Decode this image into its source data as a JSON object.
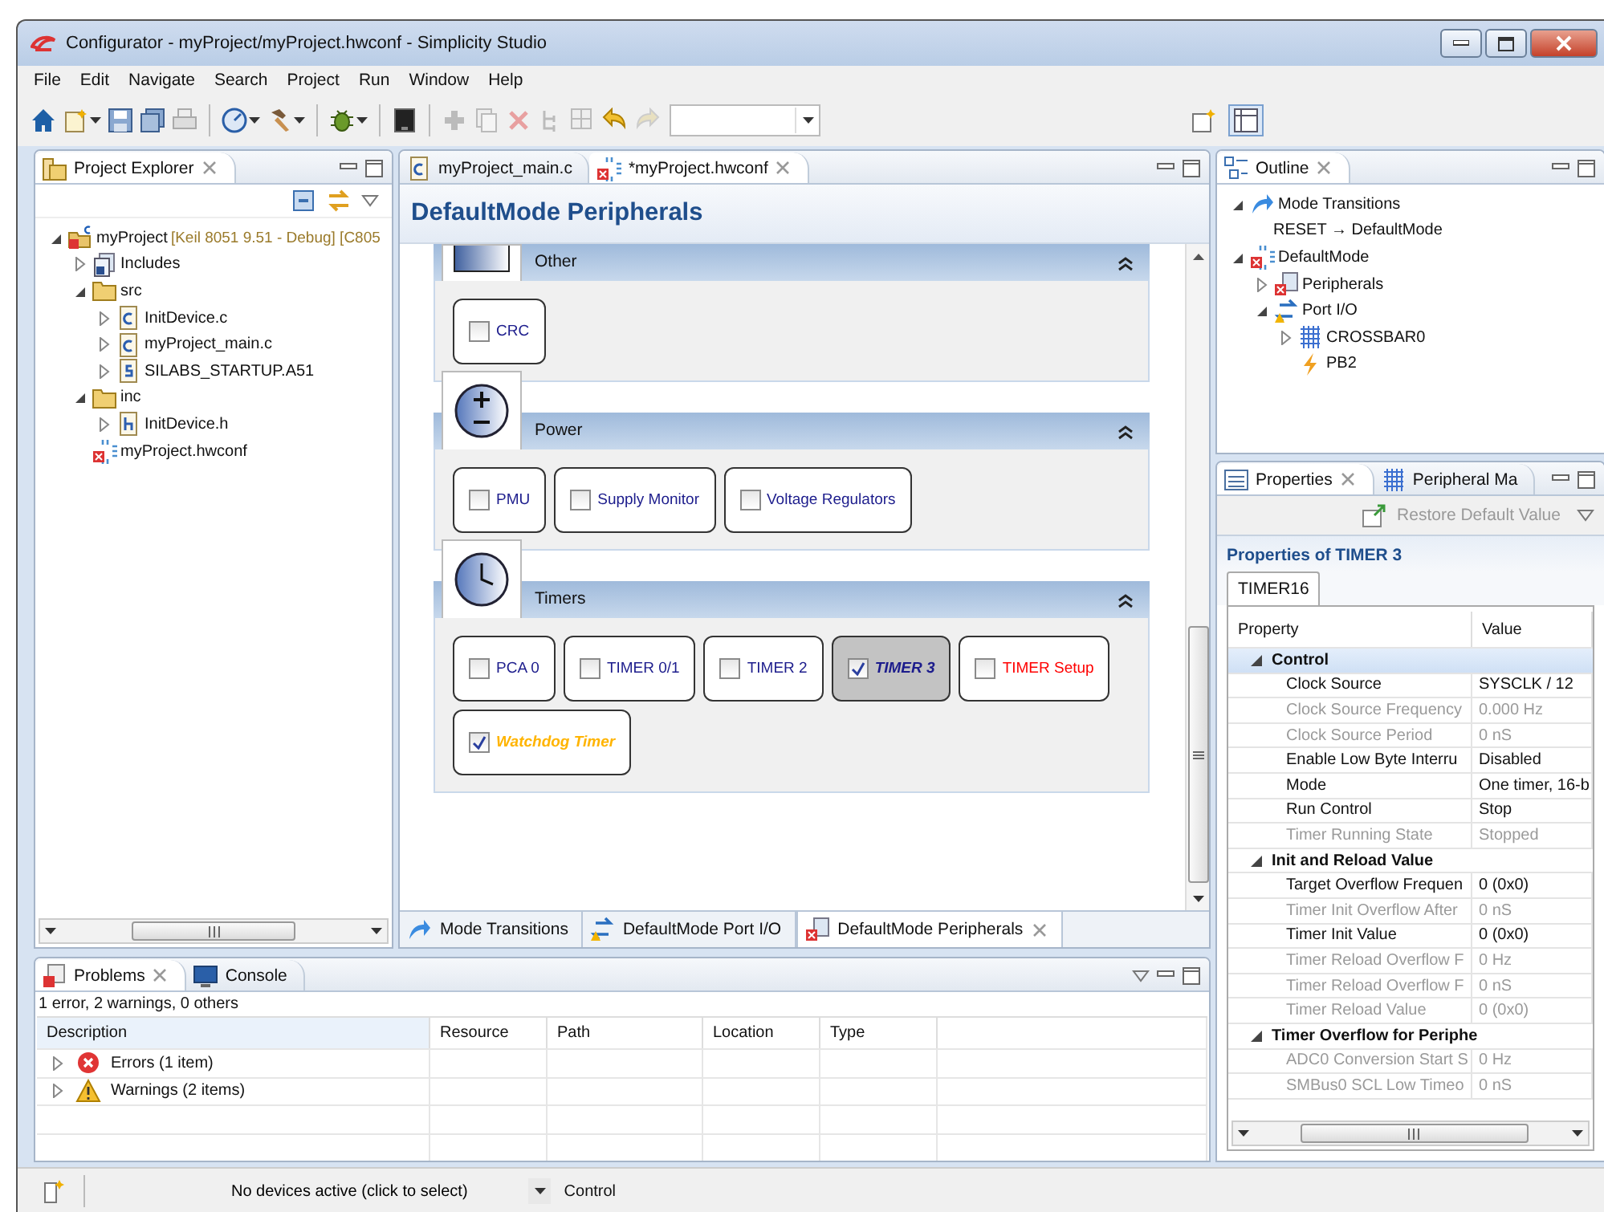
{
  "window": {
    "title": "Configurator - myProject/myProject.hwconf - Simplicity Studio"
  },
  "menu": [
    "File",
    "Edit",
    "Navigate",
    "Search",
    "Project",
    "Run",
    "Window",
    "Help"
  ],
  "project_explorer": {
    "title": "Project Explorer",
    "tree": [
      {
        "label": "myProject",
        "decoration": "[Keil 8051 9.51 - Debug] [C805",
        "kind": "project",
        "expanded": true,
        "children": [
          {
            "label": "Includes",
            "kind": "includes",
            "expanded": false
          },
          {
            "label": "src",
            "kind": "folder",
            "expanded": true,
            "children": [
              {
                "label": "InitDevice.c",
                "kind": "c-file",
                "expanded": false
              },
              {
                "label": "myProject_main.c",
                "kind": "c-file",
                "expanded": false
              },
              {
                "label": "SILABS_STARTUP.A51",
                "kind": "s-file",
                "expanded": false
              }
            ]
          },
          {
            "label": "inc",
            "kind": "folder",
            "expanded": true,
            "children": [
              {
                "label": "InitDevice.h",
                "kind": "h-file",
                "expanded": false
              }
            ]
          },
          {
            "label": "myProject.hwconf",
            "kind": "hwconf"
          }
        ]
      }
    ]
  },
  "editor": {
    "tabs": [
      {
        "label": "myProject_main.c",
        "kind": "c-file",
        "selected": false
      },
      {
        "label": "*myProject.hwconf",
        "kind": "hwconf",
        "selected": true
      }
    ],
    "heading": "DefaultMode Peripherals",
    "sections": [
      {
        "title": "Other",
        "kind": "other",
        "items": [
          {
            "label": "CRC",
            "checked": false,
            "selected": false,
            "color": "#1c1c8c"
          }
        ]
      },
      {
        "title": "Power",
        "kind": "power",
        "items": [
          {
            "label": "PMU",
            "checked": false,
            "selected": false,
            "color": "#1c1c8c"
          },
          {
            "label": "Supply Monitor",
            "checked": false,
            "selected": false,
            "color": "#1c1c8c"
          },
          {
            "label": "Voltage Regulators",
            "checked": false,
            "selected": false,
            "color": "#1c1c8c"
          }
        ]
      },
      {
        "title": "Timers",
        "kind": "timers",
        "items": [
          {
            "label": "PCA 0",
            "checked": false,
            "selected": false,
            "color": "#1c1c8c"
          },
          {
            "label": "TIMER 0/1",
            "checked": false,
            "selected": false,
            "color": "#1c1c8c"
          },
          {
            "label": "TIMER 2",
            "checked": false,
            "selected": false,
            "color": "#1c1c8c"
          },
          {
            "label": "TIMER 3",
            "checked": true,
            "selected": true,
            "color": "#1c1c8c"
          },
          {
            "label": "TIMER Setup",
            "checked": false,
            "selected": false,
            "color": "#ff0000"
          },
          {
            "label": "Watchdog Timer",
            "checked": true,
            "selected": false,
            "color": "#ffb400"
          }
        ]
      }
    ],
    "bottom_tabs": [
      {
        "label": "Mode Transitions",
        "kind": "transitions",
        "selected": false
      },
      {
        "label": "DefaultMode Port I/O",
        "kind": "port",
        "selected": false
      },
      {
        "label": "DefaultMode Peripherals",
        "kind": "peripherals",
        "selected": true
      }
    ]
  },
  "outline": {
    "title": "Outline",
    "tree": [
      {
        "label": "Mode Transitions",
        "kind": "transitions",
        "expanded": true,
        "children": [
          {
            "label": "RESET → DefaultMode",
            "kind": "plain"
          }
        ]
      },
      {
        "label": "DefaultMode",
        "kind": "hwconf",
        "expanded": true,
        "children": [
          {
            "label": "Peripherals",
            "kind": "peripherals",
            "expanded": false
          },
          {
            "label": "Port I/O",
            "kind": "port",
            "expanded": true,
            "children": [
              {
                "label": "CROSSBAR0",
                "kind": "crossbar",
                "expanded": false
              },
              {
                "label": "PB2",
                "kind": "pin"
              }
            ]
          }
        ]
      }
    ]
  },
  "properties": {
    "tabs": [
      {
        "label": "Properties",
        "kind": "properties",
        "selected": true
      },
      {
        "label": "Peripheral Ma",
        "kind": "crossbar",
        "selected": false
      }
    ],
    "restore_button": {
      "label": "Restore Default Value",
      "disabled": true
    },
    "heading": "Properties of TIMER 3",
    "subtab": "TIMER16",
    "columns": [
      "Property",
      "Value"
    ],
    "groups": [
      {
        "name": "Control",
        "expanded": true,
        "selected": true,
        "rows": [
          {
            "property": "Clock Source",
            "value": "SYSCLK / 12",
            "disabled": false
          },
          {
            "property": "Clock Source Frequency",
            "value": "0.000 Hz",
            "disabled": true
          },
          {
            "property": "Clock Source Period",
            "value": "0 nS",
            "disabled": true
          },
          {
            "property": "Enable  Low Byte Interru",
            "value": "Disabled",
            "disabled": false
          },
          {
            "property": "Mode",
            "value": "One timer, 16-b",
            "disabled": false
          },
          {
            "property": "Run Control",
            "value": "Stop",
            "disabled": false
          },
          {
            "property": "Timer Running State",
            "value": "Stopped",
            "disabled": true
          }
        ]
      },
      {
        "name": "Init and Reload Value",
        "expanded": true,
        "selected": false,
        "rows": [
          {
            "property": "Target Overflow Frequen",
            "value": "0 (0x0)",
            "disabled": false
          },
          {
            "property": "Timer Init Overflow After",
            "value": "0 nS",
            "disabled": true
          },
          {
            "property": "Timer Init Value",
            "value": "0 (0x0)",
            "disabled": false
          },
          {
            "property": "Timer Reload Overflow F",
            "value": "0 Hz",
            "disabled": true
          },
          {
            "property": "Timer Reload Overflow F",
            "value": "0 nS",
            "disabled": true
          },
          {
            "property": "Timer Reload Value",
            "value": "0 (0x0)",
            "disabled": true
          }
        ]
      },
      {
        "name": "Timer Overflow for Periphe",
        "expanded": true,
        "selected": false,
        "rows": [
          {
            "property": "ADC0 Conversion Start S",
            "value": "0 Hz",
            "disabled": true
          },
          {
            "property": "SMBus0 SCL Low Timeo",
            "value": "0 nS",
            "disabled": true
          }
        ]
      }
    ]
  },
  "problems": {
    "tabs": [
      {
        "label": "Problems",
        "kind": "problems",
        "selected": true
      },
      {
        "label": "Console",
        "kind": "console",
        "selected": false
      }
    ],
    "summary": "1 error, 2 warnings, 0 others",
    "columns": [
      "Description",
      "Resource",
      "Path",
      "Location",
      "Type"
    ],
    "rows": [
      {
        "label": "Errors (1 item)",
        "kind": "error",
        "expanded": false
      },
      {
        "label": "Warnings (2 items)",
        "kind": "warning",
        "expanded": false
      }
    ]
  },
  "status_bar": {
    "device": "No devices active (click to select)",
    "perspective": "Control"
  }
}
